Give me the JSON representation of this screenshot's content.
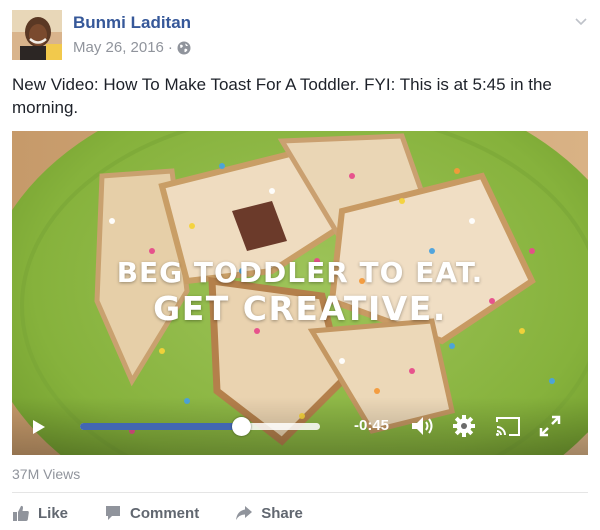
{
  "post": {
    "author": "Bunmi Laditan",
    "date": "May 26, 2016",
    "separator": "·",
    "privacy_icon": "globe-icon",
    "options_icon": "chevron-down-icon",
    "text": "New Video: How To Make Toast For A Toddler. FYI: This is at 5:45 in the morning."
  },
  "video": {
    "caption_line1": "BEG TODDLER TO EAT.",
    "caption_line2": "GET CREATIVE.",
    "time_remaining": "-0:45",
    "progress": 0.67,
    "controls": [
      "play-icon",
      "volume-icon",
      "settings-gear-icon",
      "cast-icon",
      "fullscreen-icon"
    ]
  },
  "stats": {
    "views": "37M Views"
  },
  "actions": {
    "like": "Like",
    "comment": "Comment",
    "share": "Share"
  },
  "colors": {
    "link_blue": "#365899",
    "progress_blue": "#4267b2",
    "muted_gray": "#90949c",
    "action_gray": "#616770"
  }
}
